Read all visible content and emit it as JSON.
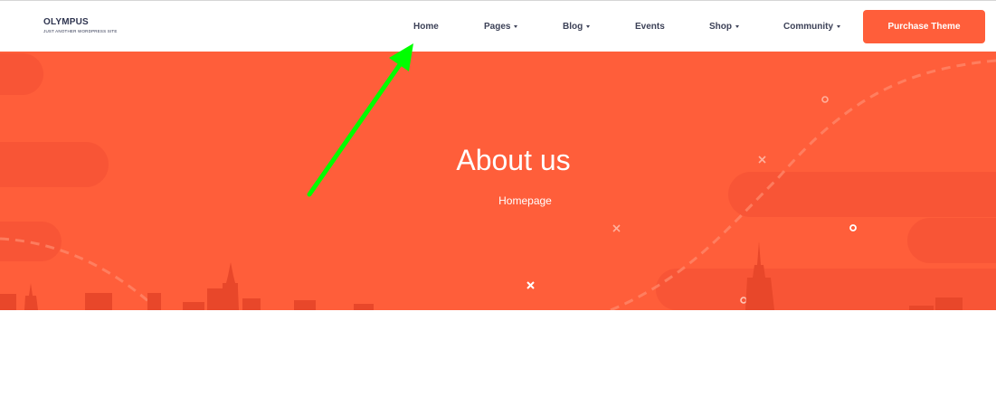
{
  "header": {
    "logo_title": "OLYMPUS",
    "logo_subtitle": "JUST ANOTHER WORDPRESS SITE",
    "nav": [
      {
        "label": "Home",
        "dropdown": false
      },
      {
        "label": "Pages",
        "dropdown": true
      },
      {
        "label": "Blog",
        "dropdown": true
      },
      {
        "label": "Events",
        "dropdown": false
      },
      {
        "label": "Shop",
        "dropdown": true
      },
      {
        "label": "Community",
        "dropdown": true
      }
    ],
    "purchase_label": "Purchase Theme"
  },
  "hero": {
    "title": "About us",
    "breadcrumb": "Homepage"
  },
  "colors": {
    "accent": "#ff5e3a",
    "hero_shade": "#f3502f",
    "nav_text": "#3c4157",
    "annotation_arrow": "#00ff00"
  },
  "annotation": {
    "type": "arrow",
    "points_to": "Home"
  }
}
